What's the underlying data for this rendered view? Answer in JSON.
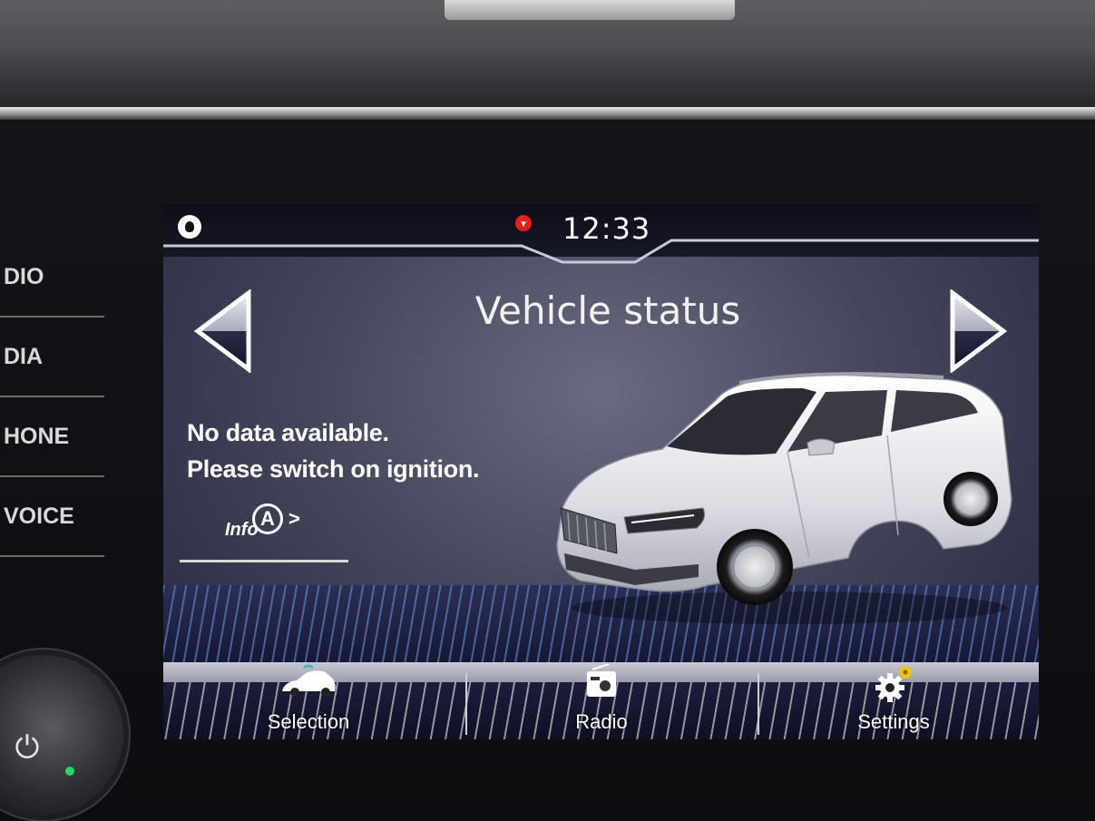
{
  "status_bar": {
    "clock": "12:33"
  },
  "screen": {
    "title": "Vehicle status",
    "message_line1": "No data available.",
    "message_line2": "Please switch on ignition.",
    "info_button": {
      "text": "Info",
      "badge": "A",
      "chevron": ">"
    }
  },
  "bottom_menu": [
    {
      "label": "Selection",
      "icon": "car-icon"
    },
    {
      "label": "Radio",
      "icon": "radio-icon"
    },
    {
      "label": "Settings",
      "icon": "gear-icon"
    }
  ],
  "hardware_buttons": [
    "DIO",
    "DIA",
    "HONE",
    "VOICE"
  ],
  "colors": {
    "alert": "#e32020",
    "accent_gear": "#f2c21b",
    "selection_icon": "#45b7d6"
  }
}
